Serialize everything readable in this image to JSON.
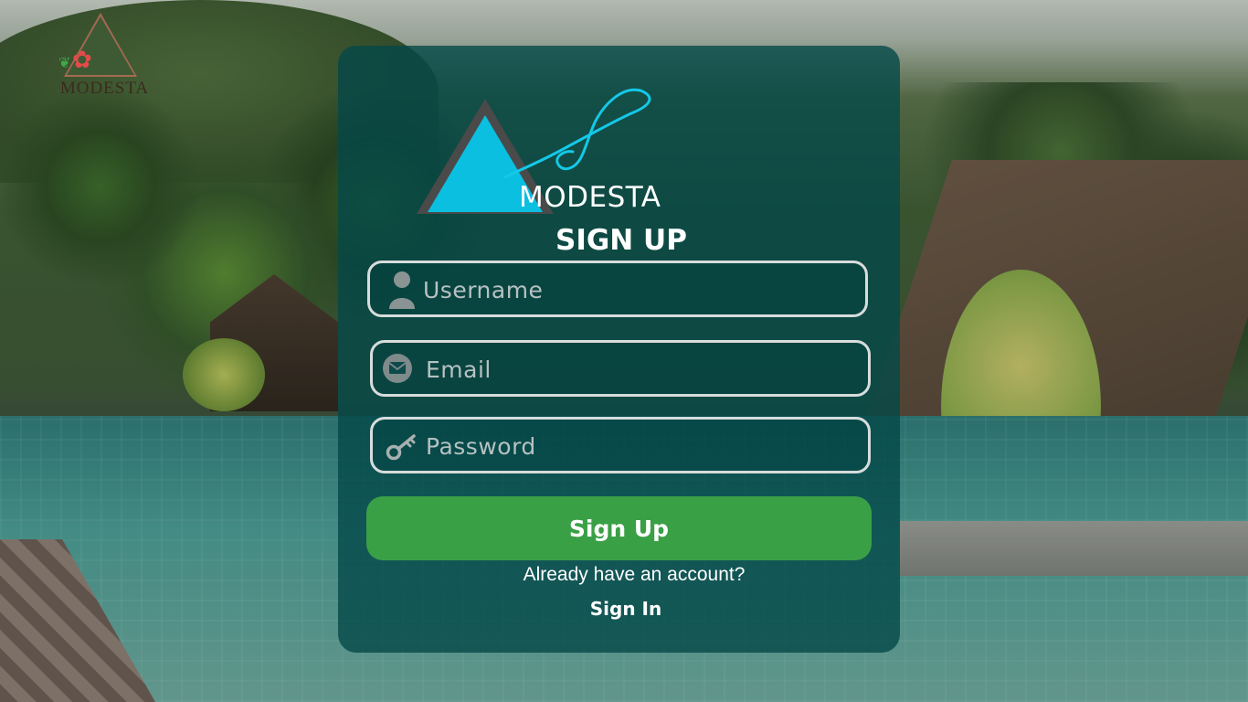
{
  "background": {
    "description_icon": "resort-pool-photo-icon"
  },
  "corner_logo": {
    "icon": "modesta-logo-icon",
    "wordmark": "MODESTA"
  },
  "card": {
    "brand": {
      "icon": "modesta-triangle-logo-icon",
      "name": "MODESTA"
    },
    "title": "SIGN UP",
    "username": {
      "placeholder": "Username",
      "value": "",
      "icon": "user-icon"
    },
    "email": {
      "placeholder": "Email",
      "value": "",
      "icon": "mail-icon"
    },
    "password": {
      "placeholder": "Password",
      "value": "",
      "icon": "key-icon"
    },
    "submit_label": "Sign Up",
    "signin_prompt": "Already have an account?",
    "signin_link": "Sign In"
  },
  "colors": {
    "card_bg": "#04484880",
    "button": "#3aa046",
    "accent_triangle": "#0bbfe0",
    "input_border": "#d7dcdc"
  }
}
